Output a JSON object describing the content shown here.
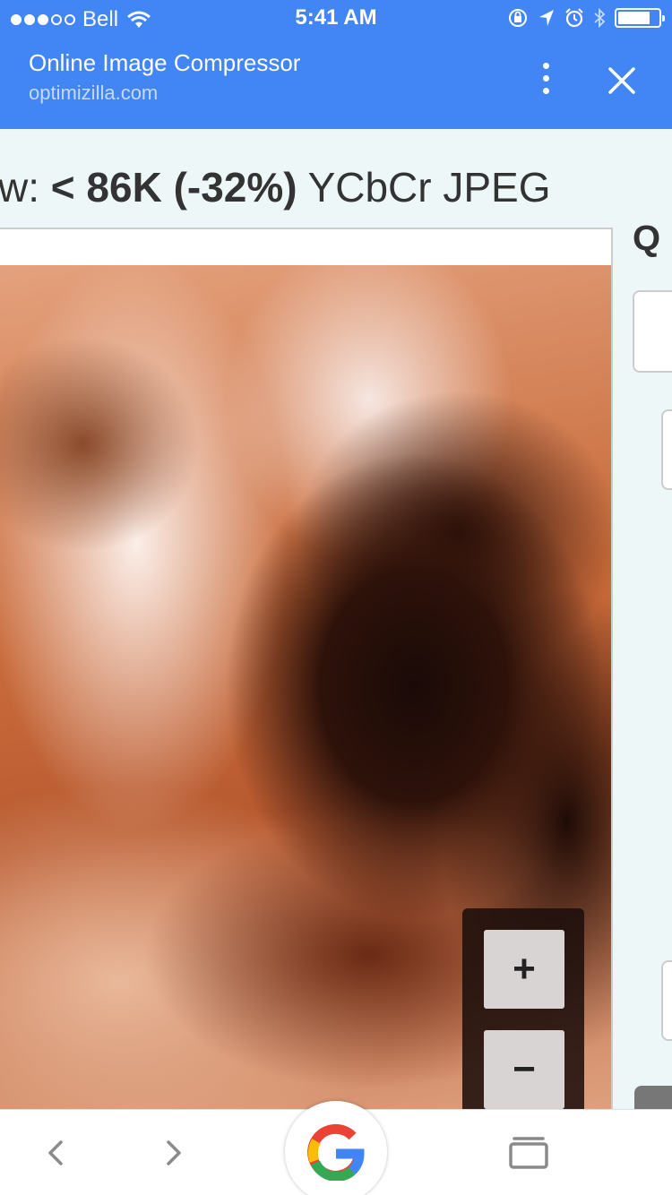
{
  "status_bar": {
    "carrier": "Bell",
    "time": "5:41 AM"
  },
  "app_bar": {
    "title": "Online Image Compressor",
    "url": "optimizilla.com"
  },
  "preview": {
    "prefix": "w: ",
    "size": "< 86K (-32%)",
    "format": " YCbCr JPEG"
  },
  "side_panel": {
    "heading_partial": "Q"
  },
  "zoom": {
    "plus_label": "+",
    "minus_label": "−"
  },
  "colors": {
    "toolbar": "#4285f4",
    "page_bg": "#eef7f7"
  },
  "icons": {
    "status": [
      "wifi-icon",
      "orientation-lock-icon",
      "location-icon",
      "alarm-icon",
      "bluetooth-icon",
      "battery-icon"
    ],
    "app_bar": [
      "more-vert-icon",
      "close-icon"
    ],
    "bottom_bar": [
      "back-icon",
      "forward-icon",
      "google-icon",
      "tabs-icon"
    ]
  }
}
